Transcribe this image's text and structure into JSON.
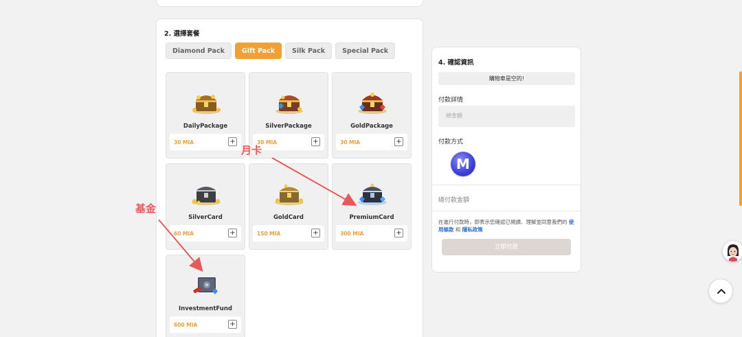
{
  "section2": {
    "title": "2. 選擇套餐",
    "tabs": [
      {
        "label": "Diamond Pack",
        "active": false
      },
      {
        "label": "Gift Pack",
        "active": true
      },
      {
        "label": "Silk Pack",
        "active": false
      },
      {
        "label": "Special Pack",
        "active": false
      }
    ],
    "items": [
      {
        "name": "DailyPackage",
        "price": "30 MIA",
        "icon": "treasure-chest-gold-icon"
      },
      {
        "name": "SilverPackage",
        "price": "30 MIA",
        "icon": "treasure-chest-gems-icon"
      },
      {
        "name": "GoldPackage",
        "price": "30 MIA",
        "icon": "treasure-chest-jewels-icon"
      },
      {
        "name": "SilverCard",
        "price": "60 MIA",
        "icon": "silver-chest-icon"
      },
      {
        "name": "GoldCard",
        "price": "150 MIA",
        "icon": "gold-chest-icon"
      },
      {
        "name": "PremiumCard",
        "price": "300 MIA",
        "icon": "premium-chest-icon"
      },
      {
        "name": "InvestmentFund",
        "price": "600 MIA",
        "icon": "investment-safe-icon"
      }
    ],
    "add_label": "+"
  },
  "section4": {
    "title": "4. 確認資訊",
    "cart_empty": "購物車是空的!",
    "payment_details_label": "付款詳情",
    "total_amount_placeholder": "總金額",
    "payment_method_label": "付款方式",
    "payment_method_icon_letter": "M",
    "total_payment_label": "總付款金額",
    "terms_prefix": "在進行付款時，即表示您確認已閱讀、理解並同意我們的",
    "terms_link": "使用條款",
    "terms_and": "和",
    "privacy_link": "隱私政策",
    "pay_button": "立即付款"
  },
  "annotations": {
    "monthly_card": "月卡",
    "fund": "基金"
  },
  "colors": {
    "accent": "#f0a035",
    "annotation": "#e85a5a",
    "link": "#2a6fd6"
  }
}
